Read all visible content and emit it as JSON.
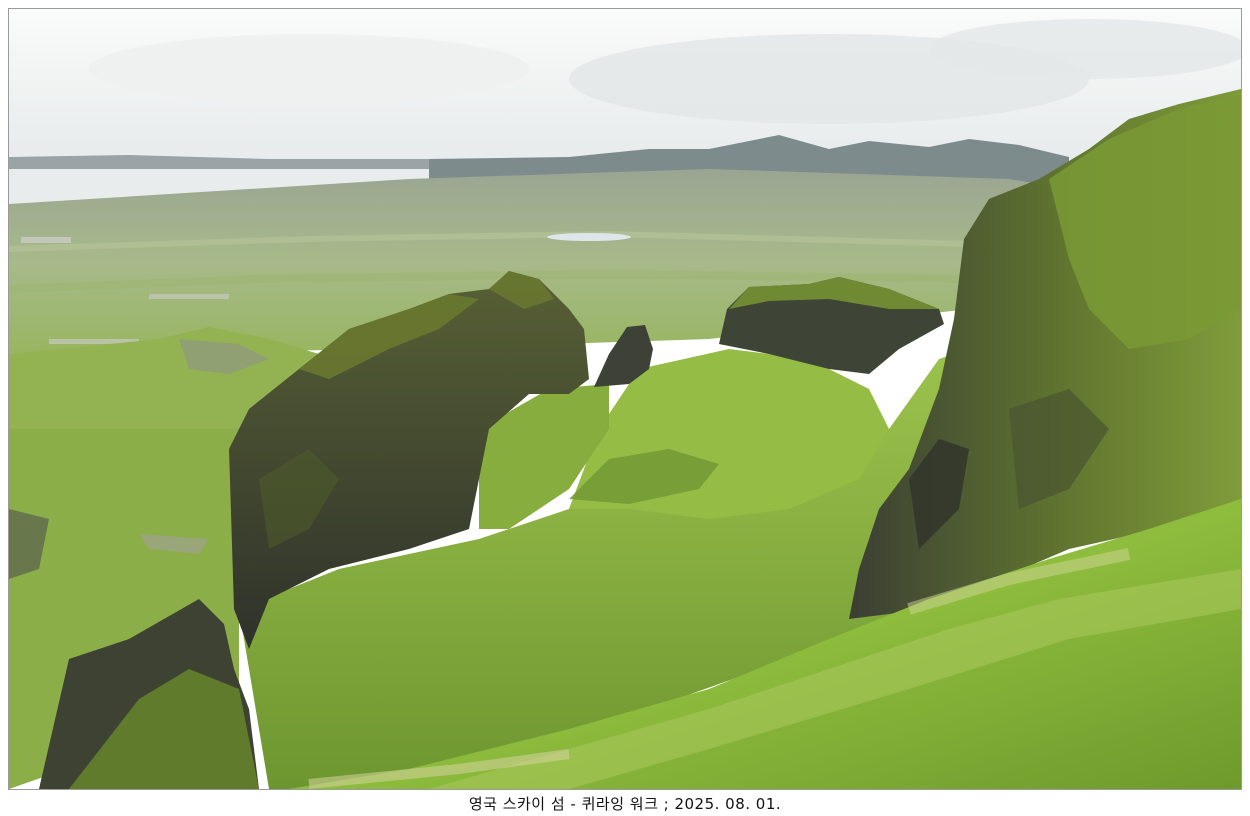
{
  "caption": "영국 스카이 섬 - 퀴라잉 워크 ; 2025. 08. 01.",
  "colors": {
    "sky": "#f1f3f3",
    "sea": "#e9eef0",
    "far_hills": "#7d8a8c",
    "plain": "#a9b88f",
    "grass_light": "#9ac14b",
    "grass_mid": "#7fa63a",
    "grass_dark": "#5f7f2a",
    "rock_dark": "#3a3d34",
    "rock_mid": "#51563f"
  }
}
